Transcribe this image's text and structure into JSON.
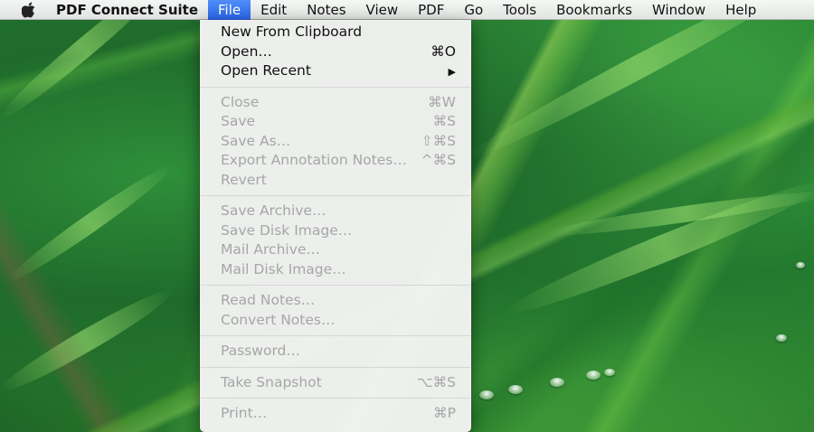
{
  "menubar": {
    "app_name": "PDF Connect Suite",
    "menus": [
      "File",
      "Edit",
      "Notes",
      "View",
      "PDF",
      "Go",
      "Tools",
      "Bookmarks",
      "Window",
      "Help"
    ],
    "active_menu": "File"
  },
  "file_menu": {
    "group1": [
      {
        "label": "New From Clipboard",
        "shortcut": "",
        "enabled": true
      },
      {
        "label": "Open…",
        "shortcut": "⌘O",
        "enabled": true
      },
      {
        "label": "Open Recent",
        "shortcut": "▶",
        "enabled": true
      }
    ],
    "group2": [
      {
        "label": "Close",
        "shortcut": "⌘W",
        "enabled": false
      },
      {
        "label": "Save",
        "shortcut": "⌘S",
        "enabled": false
      },
      {
        "label": "Save As…",
        "shortcut": "⇧⌘S",
        "enabled": false
      },
      {
        "label": "Export Annotation Notes…",
        "shortcut": "^⌘S",
        "enabled": false
      },
      {
        "label": "Revert",
        "shortcut": "",
        "enabled": false
      }
    ],
    "group3": [
      {
        "label": "Save Archive…",
        "shortcut": "",
        "enabled": false
      },
      {
        "label": "Save Disk Image…",
        "shortcut": "",
        "enabled": false
      },
      {
        "label": "Mail Archive…",
        "shortcut": "",
        "enabled": false
      },
      {
        "label": "Mail Disk Image…",
        "shortcut": "",
        "enabled": false
      }
    ],
    "group4": [
      {
        "label": "Read Notes…",
        "shortcut": "",
        "enabled": false
      },
      {
        "label": "Convert Notes…",
        "shortcut": "",
        "enabled": false
      }
    ],
    "group5": [
      {
        "label": "Password…",
        "shortcut": "",
        "enabled": false
      }
    ],
    "group6": [
      {
        "label": "Take Snapshot",
        "shortcut": "⌥⌘S",
        "enabled": false
      }
    ],
    "group7": [
      {
        "label": "Print…",
        "shortcut": "⌘P",
        "enabled": false
      }
    ]
  },
  "icons": {
    "apple": "apple-logo-icon",
    "submenu": "submenu-arrow-icon"
  },
  "colors": {
    "highlight": "#2a64e8",
    "disabled_text": "#a6a6a6",
    "enabled_text": "#111111"
  }
}
